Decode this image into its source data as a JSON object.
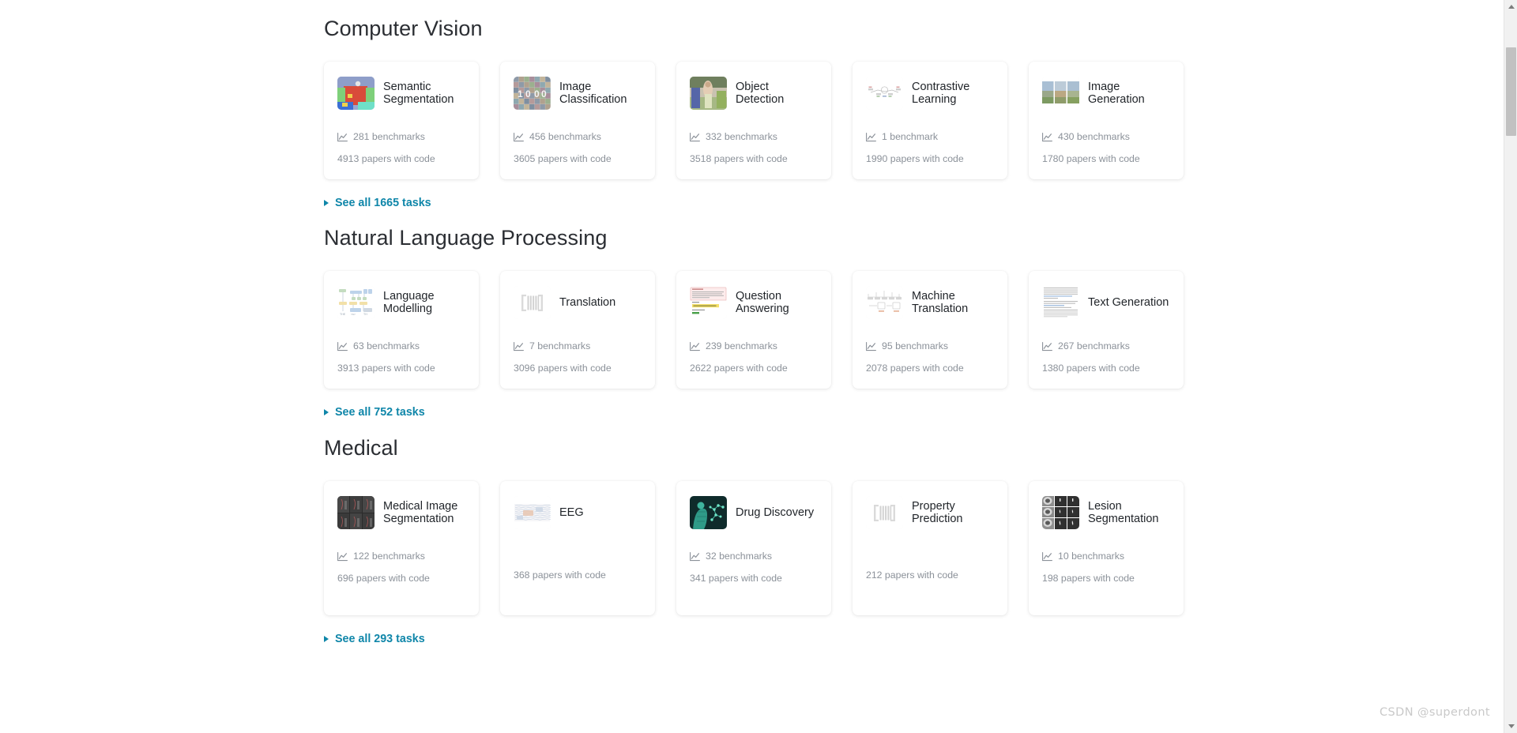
{
  "watermark": "CSDN @superdont",
  "colors": {
    "link": "#0f86a9",
    "heading": "#2b2e33",
    "card_title": "#1f2328",
    "muted": "#8b9199",
    "page_bg": "#ffffff",
    "scrollbar_track": "#f1f1f1",
    "scrollbar_thumb": "#c1c1c1"
  },
  "sections": [
    {
      "title": "Computer Vision",
      "see_all": "See all 1665 tasks",
      "cards": [
        {
          "title": "Semantic Segmentation",
          "thumb": "semantic-segmentation-thumbnail",
          "benchmarks": "281 benchmarks",
          "papers": "4913 papers with code"
        },
        {
          "title": "Image Classification",
          "thumb": "image-classification-thumbnail",
          "benchmarks": "456 benchmarks",
          "papers": "3605 papers with code"
        },
        {
          "title": "Object Detection",
          "thumb": "object-detection-thumbnail",
          "benchmarks": "332 benchmarks",
          "papers": "3518 papers with code"
        },
        {
          "title": "Contrastive Learning",
          "thumb": "contrastive-learning-thumbnail",
          "benchmarks": "1 benchmark",
          "papers": "1990 papers with code"
        },
        {
          "title": "Image Generation",
          "thumb": "image-generation-thumbnail",
          "benchmarks": "430 benchmarks",
          "papers": "1780 papers with code"
        }
      ]
    },
    {
      "title": "Natural Language Processing",
      "see_all": "See all 752 tasks",
      "cards": [
        {
          "title": "Language Modelling",
          "thumb": "language-modelling-thumbnail",
          "benchmarks": "63 benchmarks",
          "papers": "3913 papers with code"
        },
        {
          "title": "Translation",
          "thumb": "translation-thumbnail",
          "benchmarks": "7 benchmarks",
          "papers": "3096 papers with code"
        },
        {
          "title": "Question Answering",
          "thumb": "question-answering-thumbnail",
          "benchmarks": "239 benchmarks",
          "papers": "2622 papers with code"
        },
        {
          "title": "Machine Translation",
          "thumb": "machine-translation-thumbnail",
          "benchmarks": "95 benchmarks",
          "papers": "2078 papers with code"
        },
        {
          "title": "Text Generation",
          "thumb": "text-generation-thumbnail",
          "benchmarks": "267 benchmarks",
          "papers": "1380 papers with code"
        }
      ]
    },
    {
      "title": "Medical",
      "see_all": "See all 293 tasks",
      "cards": [
        {
          "title": "Medical Image Segmentation",
          "thumb": "medical-image-segmentation-thumbnail",
          "benchmarks": "122 benchmarks",
          "papers": "696 papers with code"
        },
        {
          "title": "EEG",
          "thumb": "eeg-thumbnail",
          "benchmarks": null,
          "papers": "368 papers with code"
        },
        {
          "title": "Drug Discovery",
          "thumb": "drug-discovery-thumbnail",
          "benchmarks": "32 benchmarks",
          "papers": "341 papers with code"
        },
        {
          "title": "Property Prediction",
          "thumb": "property-prediction-thumbnail",
          "benchmarks": null,
          "papers": "212 papers with code"
        },
        {
          "title": "Lesion Segmentation",
          "thumb": "lesion-segmentation-thumbnail",
          "benchmarks": "10 benchmarks",
          "papers": "198 papers with code"
        }
      ]
    }
  ]
}
